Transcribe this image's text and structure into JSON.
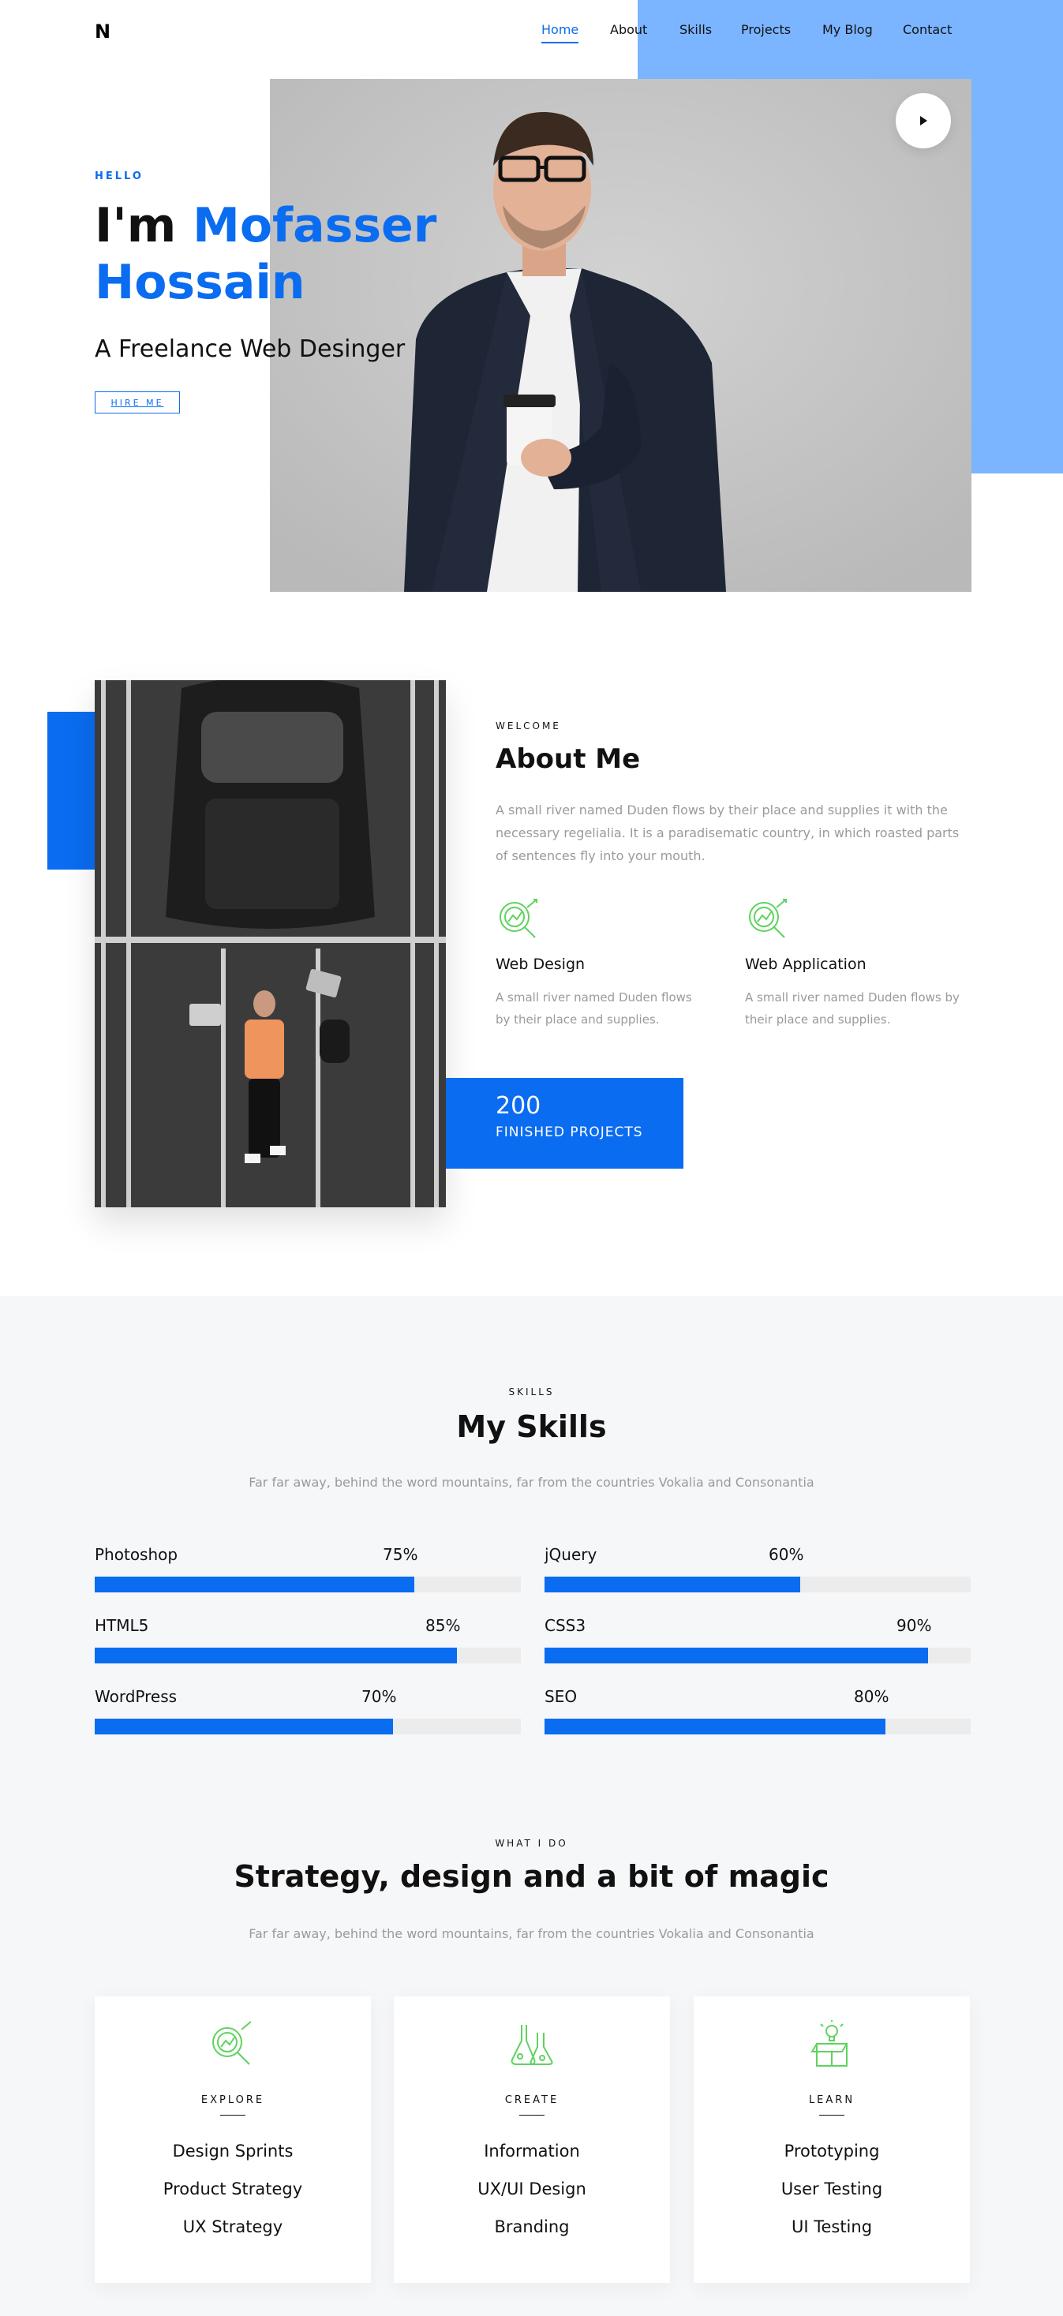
{
  "header": {
    "logo": "N",
    "nav": [
      {
        "label": "Home",
        "active": true
      },
      {
        "label": "About"
      },
      {
        "label": "Skills"
      },
      {
        "label": "Projects"
      },
      {
        "label": "My Blog"
      },
      {
        "label": "Contact"
      }
    ]
  },
  "hero": {
    "kicker": "HELLO",
    "title_prefix": "I'm",
    "title_name": "Mofasser Hossain",
    "subtitle": "A Freelance Web Desinger",
    "cta": "HIRE ME",
    "play_icon": "play-icon"
  },
  "about": {
    "kicker": "WELCOME",
    "title": "About Me",
    "text": "A small river named Duden flows by their place and supplies it with the necessary regelialia. It is a paradisematic country, in which roasted parts of sentences fly into your mouth.",
    "features": [
      {
        "title": "Web Design",
        "text": "A small river named Duden flows by their place and supplies.",
        "icon": "analytics-icon"
      },
      {
        "title": "Web Application",
        "text": "A small river named Duden flows by their place and supplies.",
        "icon": "analytics-icon"
      }
    ],
    "counter": {
      "number": "200",
      "label": "FINISHED PROJECTS"
    }
  },
  "skills": {
    "kicker": "SKILLS",
    "title": "My Skills",
    "text": "Far far away, behind the word mountains, far from the countries Vokalia and Consonantia",
    "items": [
      {
        "name": "Photoshop",
        "percent": "75%",
        "value": 75
      },
      {
        "name": "jQuery",
        "percent": "60%",
        "value": 60
      },
      {
        "name": "HTML5",
        "percent": "85%",
        "value": 85
      },
      {
        "name": "CSS3",
        "percent": "90%",
        "value": 90
      },
      {
        "name": "WordPress",
        "percent": "70%",
        "value": 70
      },
      {
        "name": "SEO",
        "percent": "80%",
        "value": 80
      }
    ]
  },
  "services": {
    "kicker": "WHAT I DO",
    "title": "Strategy, design and a bit of magic",
    "text": "Far far away, behind the word mountains, far from the countries Vokalia and Consonantia",
    "cards": [
      {
        "category": "EXPLORE",
        "icon": "analytics-icon",
        "items": [
          "Design Sprints",
          "Product Strategy",
          "UX Strategy"
        ]
      },
      {
        "category": "CREATE",
        "icon": "flask-icon",
        "items": [
          "Information",
          "UX/UI Design",
          "Branding"
        ]
      },
      {
        "category": "LEARN",
        "icon": "idea-box-icon",
        "items": [
          "Prototyping",
          "User Testing",
          "UI Testing"
        ]
      }
    ]
  },
  "colors": {
    "accent": "#0a6cf0",
    "accent_light": "#7bb4ff",
    "icon_green": "#5fd35f"
  }
}
